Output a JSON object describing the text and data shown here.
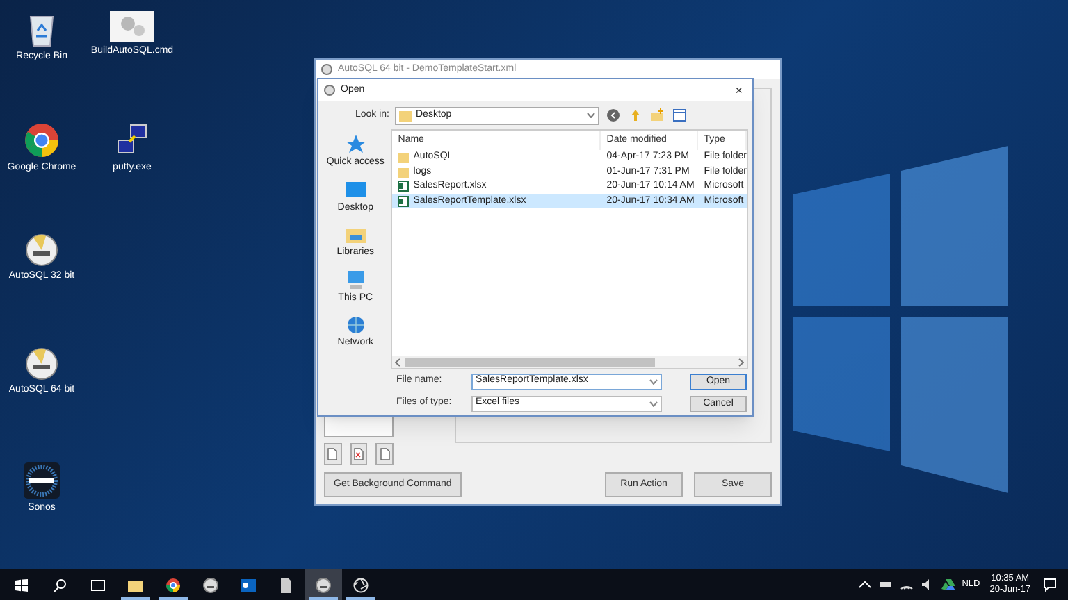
{
  "desktop_icons": [
    {
      "label": "Recycle Bin",
      "kind": "recycle"
    },
    {
      "label": "BuildAutoSQL.cmd",
      "kind": "gears"
    },
    {
      "label": "Google Chrome",
      "kind": "chrome"
    },
    {
      "label": "putty.exe",
      "kind": "putty"
    },
    {
      "label": "AutoSQL 32 bit",
      "kind": "sql"
    },
    {
      "label": "AutoSQL 64 bit",
      "kind": "sql"
    },
    {
      "label": "Sonos",
      "kind": "sonos"
    }
  ],
  "app_window": {
    "title": "AutoSQL 64 bit - DemoTemplateStart.xml",
    "buttons": [
      "Get Background Command",
      "Run Action",
      "Save"
    ]
  },
  "open_dialog": {
    "title": "Open",
    "look_in_label": "Look in:",
    "look_in_value": "Desktop",
    "places": [
      {
        "label": "Quick access",
        "kind": "star"
      },
      {
        "label": "Desktop",
        "kind": "desktop"
      },
      {
        "label": "Libraries",
        "kind": "libraries"
      },
      {
        "label": "This PC",
        "kind": "pc"
      },
      {
        "label": "Network",
        "kind": "network"
      }
    ],
    "columns": [
      "Name",
      "Date modified",
      "Type"
    ],
    "files": [
      {
        "name": "AutoSQL",
        "date": "04-Apr-17 7:23 PM",
        "type": "File folder",
        "kind": "folder",
        "selected": false
      },
      {
        "name": "logs",
        "date": "01-Jun-17 7:31 PM",
        "type": "File folder",
        "kind": "folder",
        "selected": false
      },
      {
        "name": "SalesReport.xlsx",
        "date": "20-Jun-17 10:14 AM",
        "type": "Microsoft",
        "kind": "excel",
        "selected": false
      },
      {
        "name": "SalesReportTemplate.xlsx",
        "date": "20-Jun-17 10:34 AM",
        "type": "Microsoft",
        "kind": "excel",
        "selected": true
      }
    ],
    "file_name_label": "File name:",
    "file_name": "SalesReportTemplate.xlsx",
    "file_type_label": "Files of type:",
    "file_type": "Excel files",
    "open_button": "Open",
    "cancel_button": "Cancel",
    "close_button": "×"
  },
  "taskbar": {
    "apps": [
      {
        "kind": "start",
        "running": false,
        "selected": false
      },
      {
        "kind": "search",
        "running": false,
        "selected": false
      },
      {
        "kind": "taskview",
        "running": false,
        "selected": false
      },
      {
        "kind": "explorer",
        "running": true,
        "selected": false
      },
      {
        "kind": "chrome",
        "running": true,
        "selected": false
      },
      {
        "kind": "sql",
        "running": false,
        "selected": false
      },
      {
        "kind": "outlook",
        "running": false,
        "selected": false
      },
      {
        "kind": "file",
        "running": false,
        "selected": false
      },
      {
        "kind": "sql",
        "running": true,
        "selected": true
      },
      {
        "kind": "aperture",
        "running": true,
        "selected": false
      }
    ],
    "language": "NLD",
    "time": "10:35 AM",
    "date": "20-Jun-17"
  }
}
